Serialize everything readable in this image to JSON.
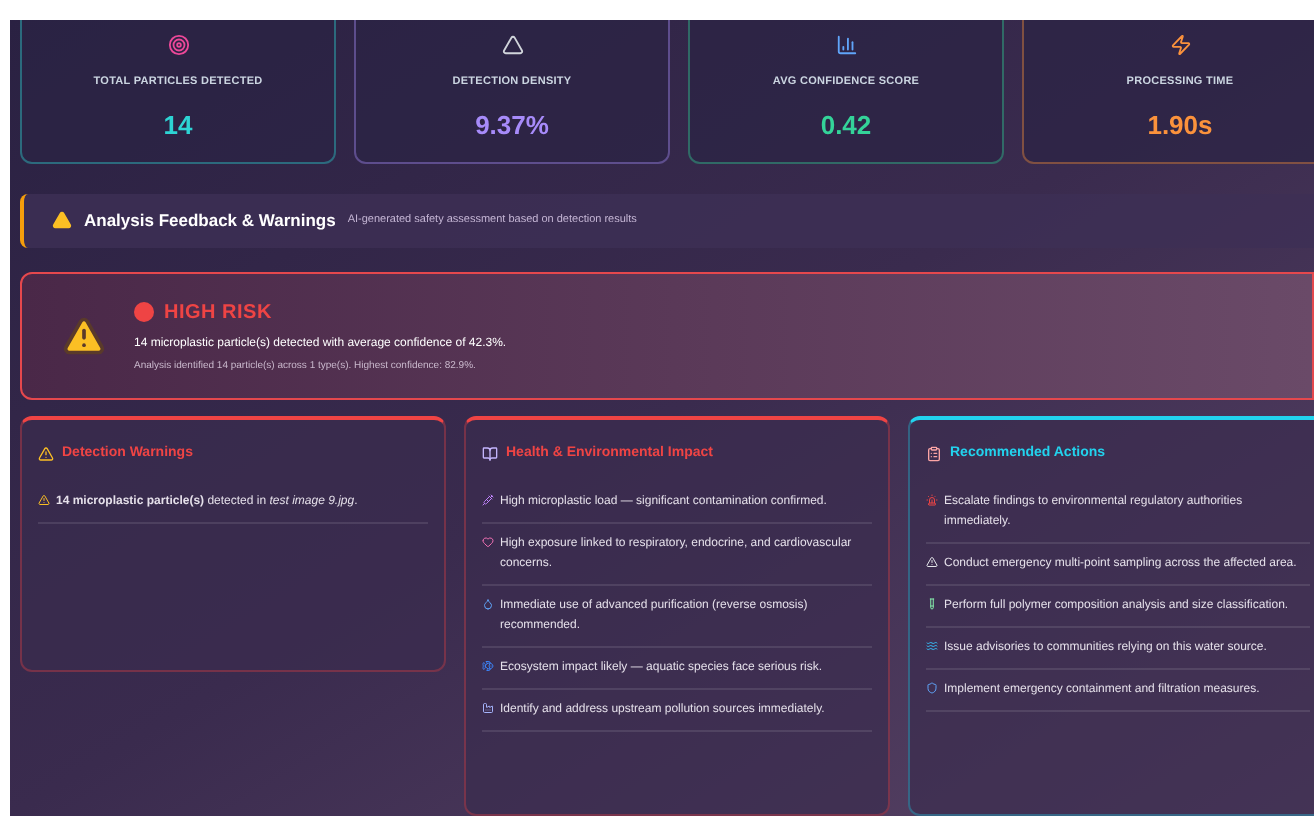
{
  "stats": [
    {
      "label": "TOTAL PARTICLES DETECTED",
      "value": "14",
      "color": "#2dd4d4"
    },
    {
      "label": "DETECTION DENSITY",
      "value": "9.37%",
      "color": "#a78bfa"
    },
    {
      "label": "AVG CONFIDENCE SCORE",
      "value": "0.42",
      "color": "#34d399"
    },
    {
      "label": "PROCESSING TIME",
      "value": "1.90s",
      "color": "#fb923c"
    }
  ],
  "feedback": {
    "title": "Analysis Feedback & Warnings",
    "subtitle": "AI-generated safety assessment based on detection results"
  },
  "risk": {
    "title": "HIGH RISK",
    "summary": "14 microplastic particle(s) detected with average confidence of 42.3%.",
    "detail": "Analysis identified 14 particle(s) across 1 type(s). Highest confidence: 82.9%."
  },
  "panels": [
    {
      "title": "Detection Warnings",
      "color": "#ef4444",
      "items": [
        "**14 microplastic particle(s)** detected in *test image 9.jpg*."
      ]
    },
    {
      "title": "Health & Environmental Impact",
      "color": "#ef4444",
      "items": [
        "High microplastic load — significant contamination confirmed.",
        "High exposure linked to respiratory, endocrine, and cardiovascular concerns.",
        "Immediate use of advanced purification (reverse osmosis) recommended.",
        "Ecosystem impact likely — aquatic species face serious risk.",
        "Identify and address upstream pollution sources immediately."
      ]
    },
    {
      "title": "Recommended Actions",
      "color": "#22d3ee",
      "items": [
        "Escalate findings to environmental regulatory authorities immediately.",
        "Conduct emergency multi-point sampling across the affected area.",
        "Perform full polymer composition analysis and size classification.",
        "Issue advisories to communities relying on this water source.",
        "Implement emergency containment and filtration measures."
      ]
    }
  ]
}
